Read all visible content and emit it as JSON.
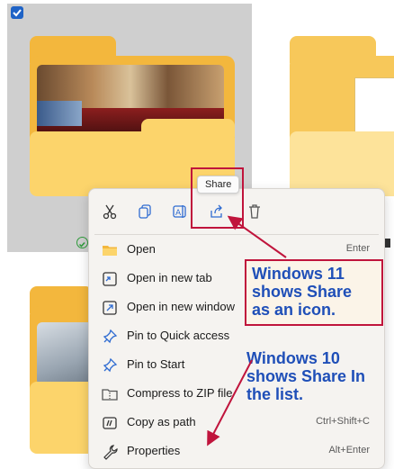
{
  "tooltip": {
    "text": "Share"
  },
  "callouts": {
    "win11": [
      "Windows 11",
      "shows Share",
      "as an icon."
    ],
    "win10": [
      "Windows 10",
      "shows Share In",
      "the list."
    ]
  },
  "icon_bar": [
    {
      "name": "cut-icon"
    },
    {
      "name": "copy-icon"
    },
    {
      "name": "rename-icon"
    },
    {
      "name": "share-icon"
    },
    {
      "name": "delete-icon"
    }
  ],
  "menu_items": [
    {
      "label": "Open",
      "shortcut": "Enter",
      "icon": "folder-icon"
    },
    {
      "label": "Open in new tab",
      "shortcut": "",
      "icon": "new-tab-icon"
    },
    {
      "label": "Open in new window",
      "shortcut": "",
      "icon": "new-window-icon"
    },
    {
      "label": "Pin to Quick access",
      "shortcut": "",
      "icon": "pin-icon"
    },
    {
      "label": "Pin to Start",
      "shortcut": "",
      "icon": "pin-start-icon"
    },
    {
      "label": "Compress to ZIP file",
      "shortcut": "",
      "icon": "zip-icon"
    },
    {
      "label": "Copy as path",
      "shortcut": "Ctrl+Shift+C",
      "icon": "copy-path-icon"
    },
    {
      "label": "Properties",
      "shortcut": "Alt+Enter",
      "icon": "properties-icon"
    }
  ],
  "colors": {
    "accent": "#1f63c6",
    "annotation_red": "#c0143c",
    "annotation_blue": "#1f4fb8"
  }
}
